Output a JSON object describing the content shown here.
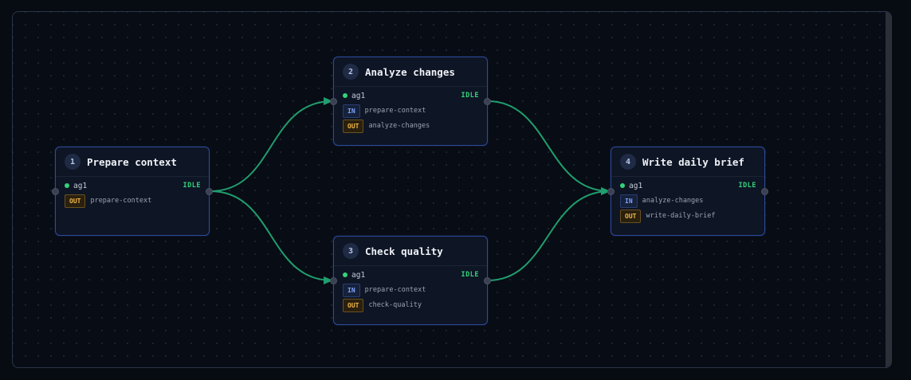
{
  "nodes": [
    {
      "number": "1",
      "title": "Prepare context",
      "agent": "ag1",
      "status": "IDLE",
      "inputs": [],
      "outputs": [
        "prepare-context"
      ]
    },
    {
      "number": "2",
      "title": "Analyze changes",
      "agent": "ag1",
      "status": "IDLE",
      "inputs": [
        "prepare-context"
      ],
      "outputs": [
        "analyze-changes"
      ]
    },
    {
      "number": "3",
      "title": "Check quality",
      "agent": "ag1",
      "status": "IDLE",
      "inputs": [
        "prepare-context"
      ],
      "outputs": [
        "check-quality"
      ]
    },
    {
      "number": "4",
      "title": "Write daily brief",
      "agent": "ag1",
      "status": "IDLE",
      "inputs": [
        "analyze-changes"
      ],
      "outputs": [
        "write-daily-brief"
      ]
    }
  ],
  "labels": {
    "in": "IN",
    "out": "OUT"
  },
  "edges": [
    {
      "from": "1",
      "to": "2"
    },
    {
      "from": "1",
      "to": "3"
    },
    {
      "from": "2",
      "to": "4"
    },
    {
      "from": "3",
      "to": "4"
    }
  ],
  "colors": {
    "edge": "#1f9e6e",
    "node_border": "#2d4a9a",
    "status_idle": "#34d17b",
    "in_tag": "#7fa4ff",
    "out_tag": "#f0b64a"
  }
}
